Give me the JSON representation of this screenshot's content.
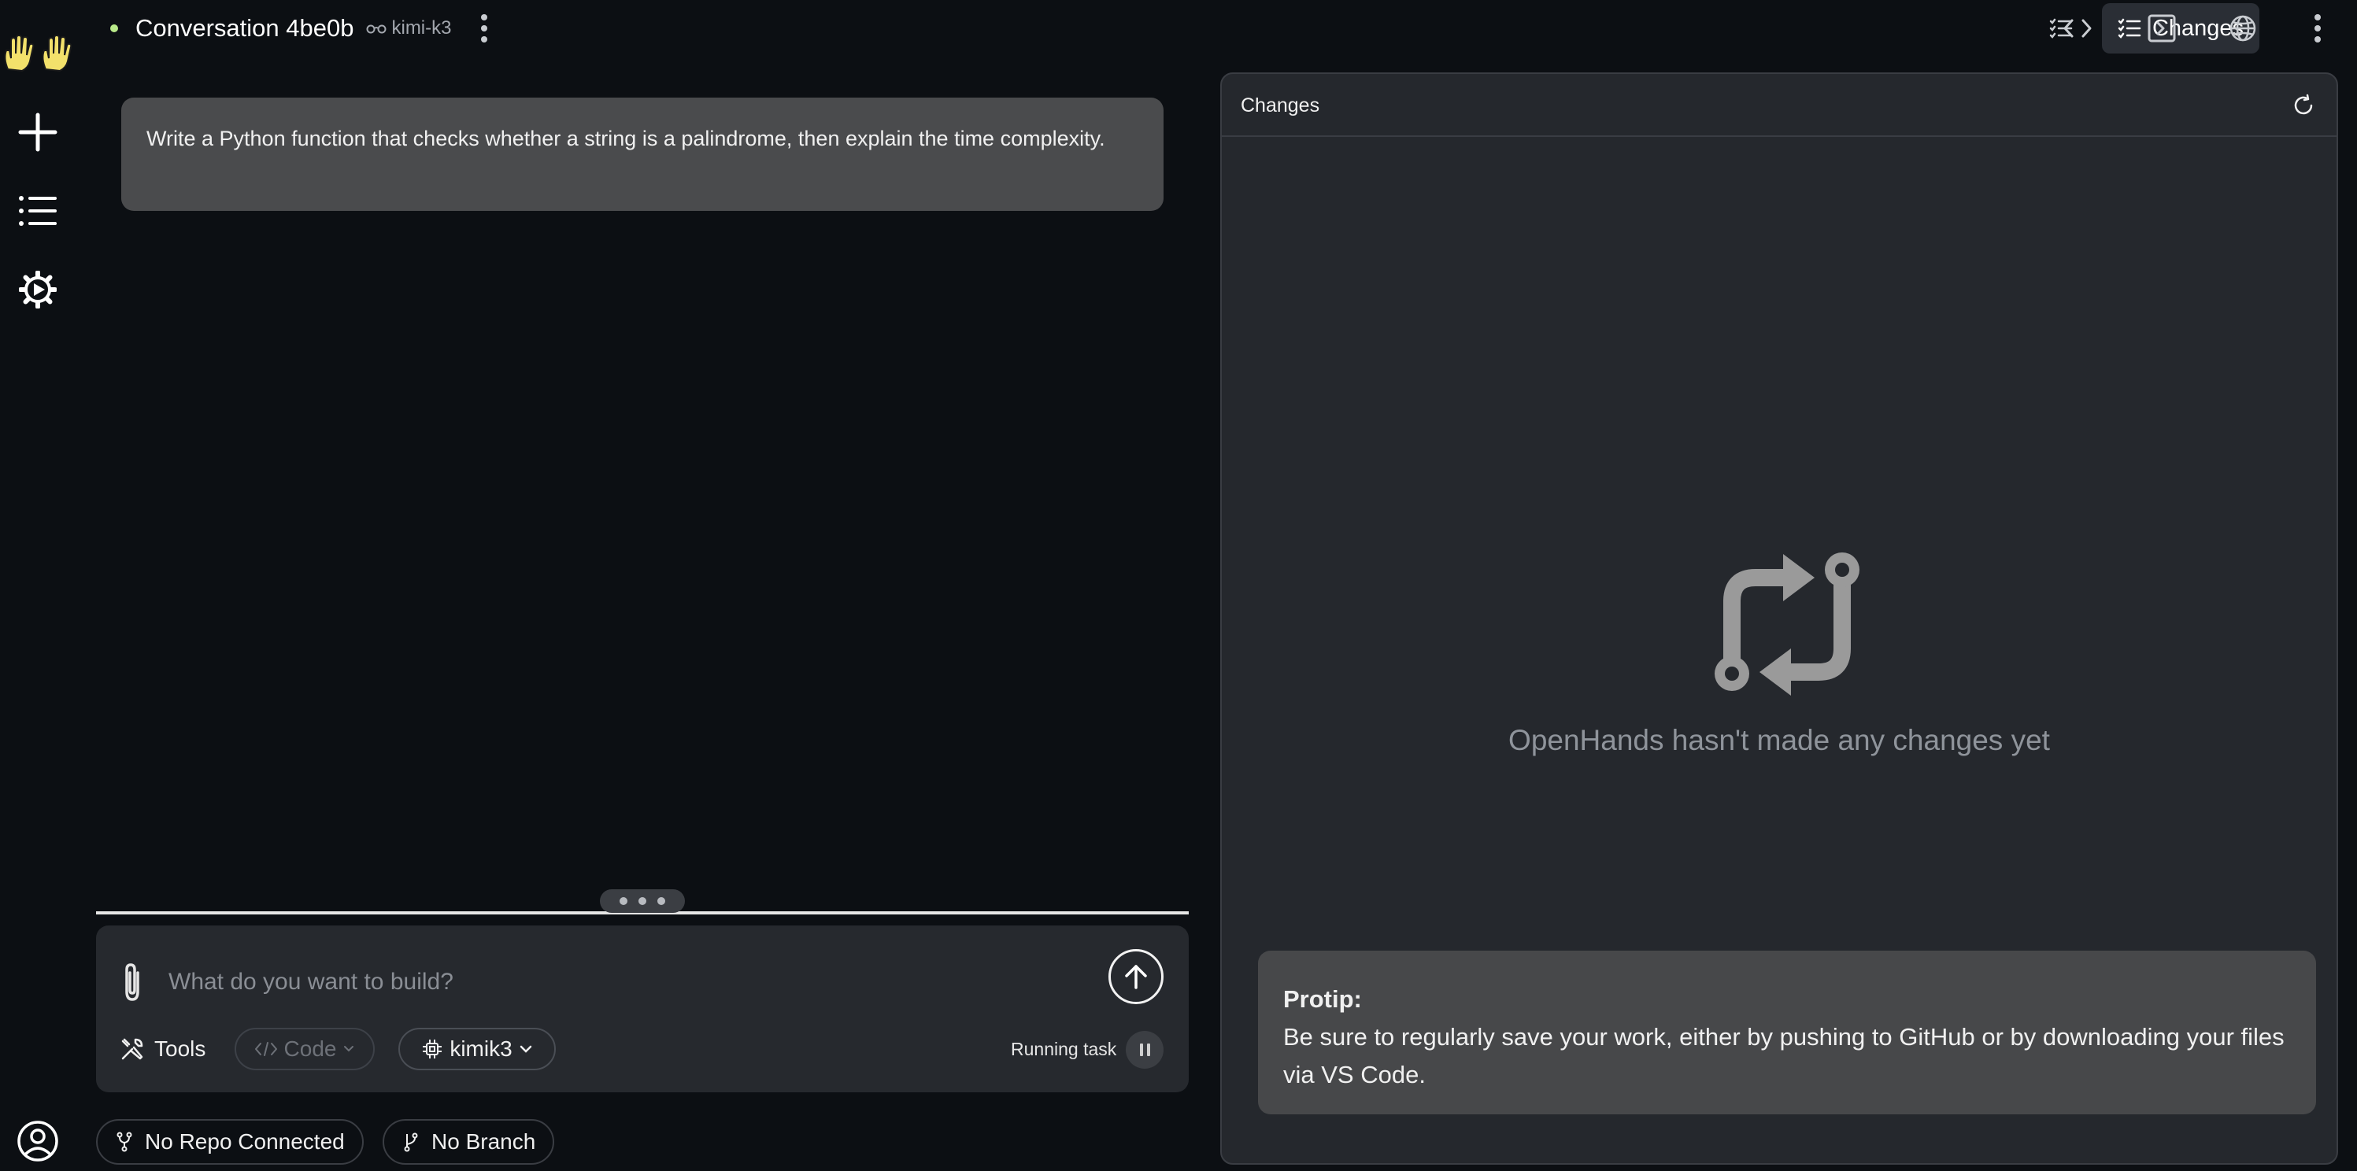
{
  "conversation": {
    "title": "Conversation 4be0b",
    "model": "kimi-k3"
  },
  "top_tabs": {
    "active_label": "Changes"
  },
  "chat": {
    "user_message": "Write a Python function that checks whether a string is a palindrome, then explain the time complexity."
  },
  "composer": {
    "placeholder": "What do you want to build?",
    "tools_label": "Tools",
    "code_label": "Code",
    "model_label": "kimik3",
    "running_label": "Running task"
  },
  "repo_bar": {
    "repo_label": "No Repo Connected",
    "branch_label": "No Branch"
  },
  "changes_panel": {
    "title": "Changes",
    "empty_text": "OpenHands hasn't made any changes yet",
    "protip_title": "Protip:",
    "protip_body": "Be sure to regularly save your work, either by pushing to GitHub or by downloading your files via VS Code."
  },
  "icons": {
    "logo": "raised-hands-icon",
    "new": "plus-icon",
    "list": "list-icon",
    "settings": "gear-play-icon",
    "user": "user-circle-icon",
    "tab_tasks": "task-list-icon",
    "tab_changes": "checklist-icon",
    "tab_code": "code-icon",
    "tab_terminal": "terminal-icon",
    "tab_browser": "globe-icon",
    "more": "kebab-icon",
    "empty_state": "pull-request-icon"
  },
  "colors": {
    "background": "#0c0f13",
    "panel": "#25282d",
    "status_dot": "#b9e98a",
    "logo_yellow": "#f3e16b"
  }
}
